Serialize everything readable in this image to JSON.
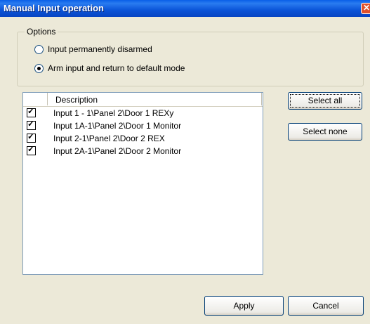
{
  "window": {
    "title": "Manual Input operation",
    "close_icon": "close-icon"
  },
  "options": {
    "legend": "Options",
    "radios": [
      {
        "label": "Input permanently disarmed",
        "selected": false
      },
      {
        "label": "Arm input and return to default mode",
        "selected": true
      }
    ]
  },
  "list": {
    "header": "Description",
    "rows": [
      {
        "checked": true,
        "text": "Input 1 - 1\\Panel 2\\Door 1 REXy"
      },
      {
        "checked": true,
        "text": "Input 1A-1\\Panel 2\\Door 1 Monitor"
      },
      {
        "checked": true,
        "text": "Input 2-1\\Panel 2\\Door 2 REX"
      },
      {
        "checked": true,
        "text": "Input 2A-1\\Panel 2\\Door 2 Monitor"
      }
    ]
  },
  "buttons": {
    "select_all": "Select all",
    "select_none": "Select none",
    "apply": "Apply",
    "cancel": "Cancel"
  }
}
